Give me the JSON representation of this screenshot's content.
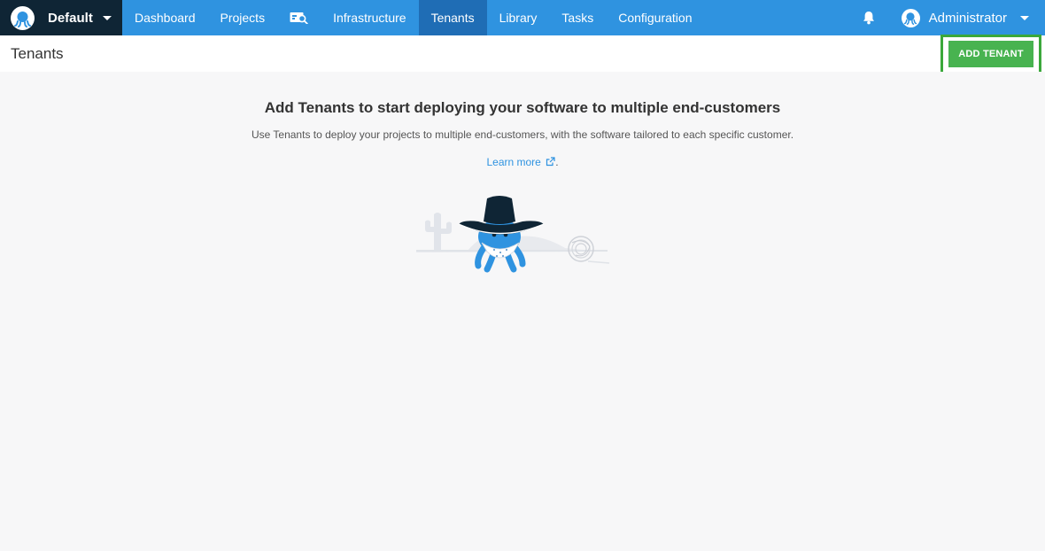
{
  "topbar": {
    "space": "Default",
    "nav": [
      {
        "label": "Dashboard"
      },
      {
        "label": "Projects"
      },
      {
        "label": "Infrastructure"
      },
      {
        "label": "Tenants",
        "active": true
      },
      {
        "label": "Library"
      },
      {
        "label": "Tasks"
      },
      {
        "label": "Configuration"
      }
    ],
    "user": "Administrator",
    "icons": {
      "logo": "octopus-logo-icon",
      "search_board": "search-board-icon",
      "bell": "bell-icon",
      "avatar": "user-avatar-icon"
    }
  },
  "header": {
    "title": "Tenants",
    "add_button": "ADD TENANT"
  },
  "empty_state": {
    "title": "Add Tenants to start deploying your software to multiple end-customers",
    "description": "Use Tenants to deploy your projects to multiple end-customers, with the software tailored to each specific customer.",
    "learn_more": "Learn more",
    "learn_suffix": "."
  },
  "colors": {
    "topbar": "#2f93e0",
    "space_switcher": "#0f2535",
    "active_tab": "#1f6db5",
    "add_button": "#48b350",
    "highlight": "#3ba83b",
    "link": "#2f93e0"
  }
}
